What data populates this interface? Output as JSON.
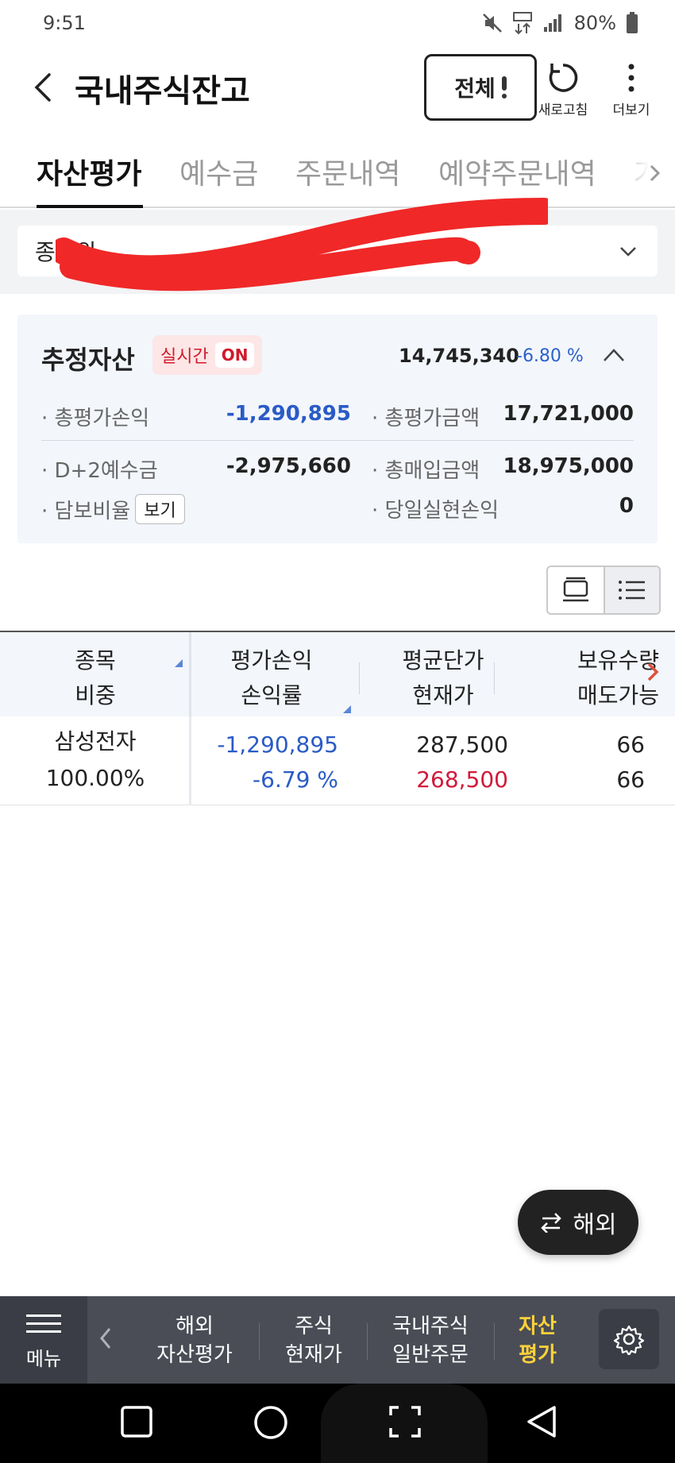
{
  "status_bar": {
    "time": "9:51",
    "battery": "80%"
  },
  "header": {
    "title": "국내주식잔고",
    "all_button": "전체",
    "refresh_label": "새로고침",
    "more_label": "더보기"
  },
  "tabs": [
    {
      "label": "자산평가",
      "active": true
    },
    {
      "label": "예수금"
    },
    {
      "label": "주문내역"
    },
    {
      "label": "예약주문내역"
    },
    {
      "label": "거"
    }
  ],
  "account": {
    "label": "종합위"
  },
  "summary": {
    "title": "추정자산",
    "realtime_label": "실시간",
    "realtime_state": "ON",
    "total_value": "14,745,340",
    "total_pct": "-6.80 %",
    "rows": [
      {
        "l1": "총평가손익",
        "v1": "-1,290,895",
        "l2": "총평가금액",
        "v2": "17,721,000"
      },
      {
        "l1": "D+2예수금",
        "v1": "-2,975,660",
        "l2": "총매입금액",
        "v2": "18,975,000"
      },
      {
        "l1": "담보비율",
        "btn": "보기",
        "l2": "당일실현손익",
        "v2": "0"
      }
    ]
  },
  "table": {
    "headers": [
      {
        "line1": "종목",
        "line2": "비중"
      },
      {
        "line1": "평가손익",
        "line2": "손익률"
      },
      {
        "line1": "평균단가",
        "line2": "현재가"
      },
      {
        "line1": "보유수량",
        "line2": "매도가능"
      }
    ],
    "rows": [
      {
        "name": "삼성전자",
        "weight": "100.00%",
        "pnl": "-1,290,895",
        "pnl_rate": "-6.79 %",
        "avg_price": "287,500",
        "current_price": "268,500",
        "qty": "66",
        "sellable": "66"
      }
    ]
  },
  "fab": {
    "label": "해외"
  },
  "bottom_nav": {
    "menu_label": "메뉴",
    "items": [
      {
        "line1": "해외",
        "line2": "자산평가"
      },
      {
        "line1": "주식",
        "line2": "현재가"
      },
      {
        "line1": "국내주식",
        "line2": "일반주문"
      },
      {
        "line1": "자산",
        "line2": "평가",
        "active": true
      }
    ]
  },
  "colors": {
    "negative_blue": "#2a5bc6",
    "positive_red": "#d11a3a",
    "active_yellow": "#ffd23a"
  }
}
